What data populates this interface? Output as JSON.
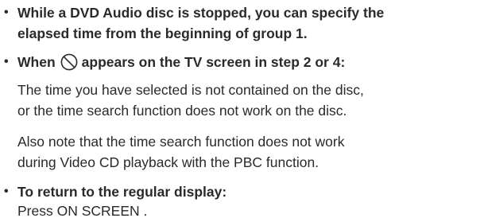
{
  "notes": [
    {
      "bullet": "•",
      "heading_lines": [
        "While a DVD Audio disc is stopped, you can specify the",
        "elapsed time from the beginning of group 1."
      ]
    },
    {
      "bullet": "•",
      "heading_pre": "When",
      "heading_icon": "prohibited-icon",
      "heading_post": "appears on the TV screen in step 2 or 4:",
      "paragraphs": [
        [
          "The time you have selected is not contained on the disc,",
          "or the time search function does not work on the disc."
        ],
        [
          "Also note that the time search function does not work",
          "during Video CD playback with the PBC function."
        ]
      ]
    },
    {
      "bullet": "•",
      "heading": "To return to the regular display:",
      "body": "Press ON SCREEN ."
    }
  ]
}
